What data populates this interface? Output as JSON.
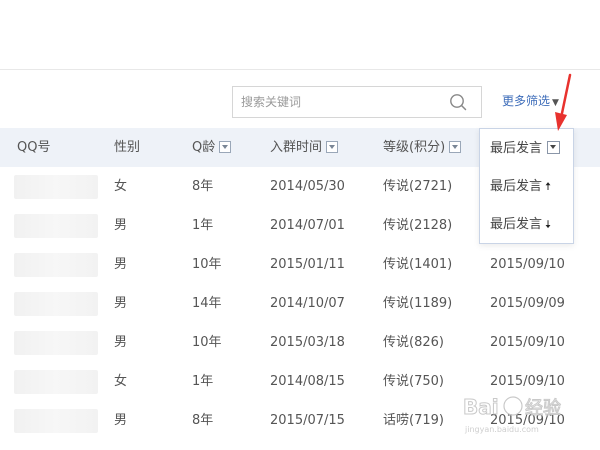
{
  "search": {
    "placeholder": "搜索关键词"
  },
  "filter": {
    "more_label": "更多筛选"
  },
  "columns": [
    {
      "key": "qq",
      "label": "QQ号",
      "sortable": false
    },
    {
      "key": "gender",
      "label": "性别",
      "sortable": false
    },
    {
      "key": "age",
      "label": "Q龄",
      "sortable": true
    },
    {
      "key": "join",
      "label": "入群时间",
      "sortable": true
    },
    {
      "key": "level",
      "label": "等级(积分)",
      "sortable": true
    },
    {
      "key": "last",
      "label": "最后发言",
      "sortable": true
    }
  ],
  "rows": [
    {
      "gender": "女",
      "age": "8年",
      "join": "2014/05/30",
      "level": "传说(2721)",
      "last": ""
    },
    {
      "gender": "男",
      "age": "1年",
      "join": "2014/07/01",
      "level": "传说(2128)",
      "last": ""
    },
    {
      "gender": "男",
      "age": "10年",
      "join": "2015/01/11",
      "level": "传说(1401)",
      "last": "2015/09/10"
    },
    {
      "gender": "男",
      "age": "14年",
      "join": "2014/10/07",
      "level": "传说(1189)",
      "last": "2015/09/09"
    },
    {
      "gender": "男",
      "age": "10年",
      "join": "2015/03/18",
      "level": "传说(826)",
      "last": "2015/09/10"
    },
    {
      "gender": "女",
      "age": "1年",
      "join": "2014/08/15",
      "level": "传说(750)",
      "last": "2015/09/10"
    },
    {
      "gender": "男",
      "age": "8年",
      "join": "2015/07/15",
      "level": "话唠(719)",
      "last": "2015/09/10"
    }
  ],
  "dropdown": {
    "header": "最后发言",
    "items": [
      {
        "label": "最后发言",
        "arrow": "🠅"
      },
      {
        "label": "最后发言",
        "arrow": "🠇"
      }
    ]
  },
  "colors": {
    "accent": "#3d6cb9",
    "header_bg": "#eef2f8",
    "annotation": "#e8322e"
  },
  "icons": {
    "search": "search-icon",
    "annotation": "red-arrow-icon"
  }
}
